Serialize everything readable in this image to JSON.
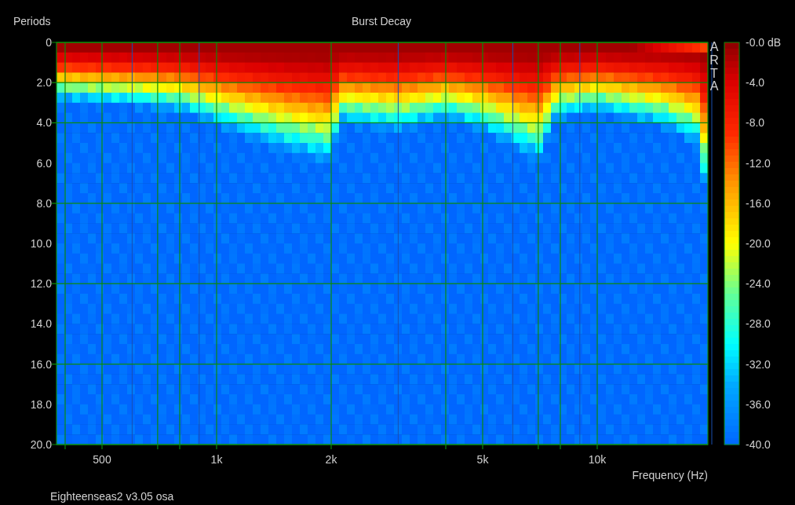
{
  "chart": {
    "title": "Burst Decay",
    "y_axis_label": "Periods",
    "x_axis_label": "Frequency (Hz)",
    "y_ticks": [
      "0",
      "2.0",
      "4.0",
      "6.0",
      "8.0",
      "10.0",
      "12.0",
      "14.0",
      "16.0",
      "18.0",
      "20.0"
    ],
    "x_ticks": [
      "500",
      "1k",
      "2k",
      "5k",
      "10k"
    ],
    "logo": "ARTA",
    "color_scale_ticks": [
      "-0.0 dB",
      "-4.0",
      "-8.0",
      "-12.0",
      "-16.0",
      "-20.0",
      "-24.0",
      "-28.0",
      "-32.0",
      "-36.0",
      "-40.0"
    ]
  },
  "footer": "Eighteenseas2 v3.05 osa"
}
